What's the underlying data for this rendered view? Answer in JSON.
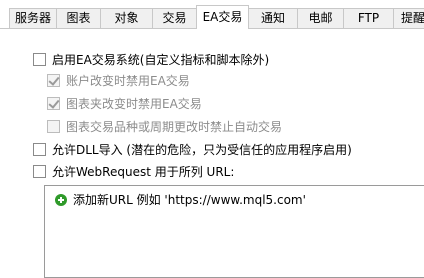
{
  "tabs": [
    {
      "label": "服务器"
    },
    {
      "label": "图表"
    },
    {
      "label": "对象"
    },
    {
      "label": "交易"
    },
    {
      "label": "EA交易"
    },
    {
      "label": "通知"
    },
    {
      "label": "电邮"
    },
    {
      "label": "FTP"
    },
    {
      "label": "提醒"
    }
  ],
  "active_tab": "EA交易",
  "options": {
    "enable_ea": {
      "label": "启用EA交易系统(自定义指标和脚本除外)",
      "checked": false
    },
    "disable_on_account_change": {
      "label": "账户改变时禁用EA交易",
      "checked": true,
      "disabled": true
    },
    "disable_on_profile_change": {
      "label": "图表夹改变时禁用EA交易",
      "checked": true,
      "disabled": true
    },
    "disable_on_symbol_change": {
      "label": "图表交易品种或周期更改时禁止自动交易",
      "checked": false,
      "disabled": true
    },
    "allow_dll": {
      "label": "允许DLL导入 (潜在的危险，只为受信任的应用程序启用)",
      "checked": false
    },
    "allow_webrequest": {
      "label": "允许WebRequest 用于所列 URL:",
      "checked": false
    }
  },
  "url_list": {
    "add_item": "添加新URL 例如 'https://www.mql5.com'"
  },
  "colors": {
    "add_icon": "#2f9a2a",
    "disabled_text": "#8c8c8c"
  }
}
